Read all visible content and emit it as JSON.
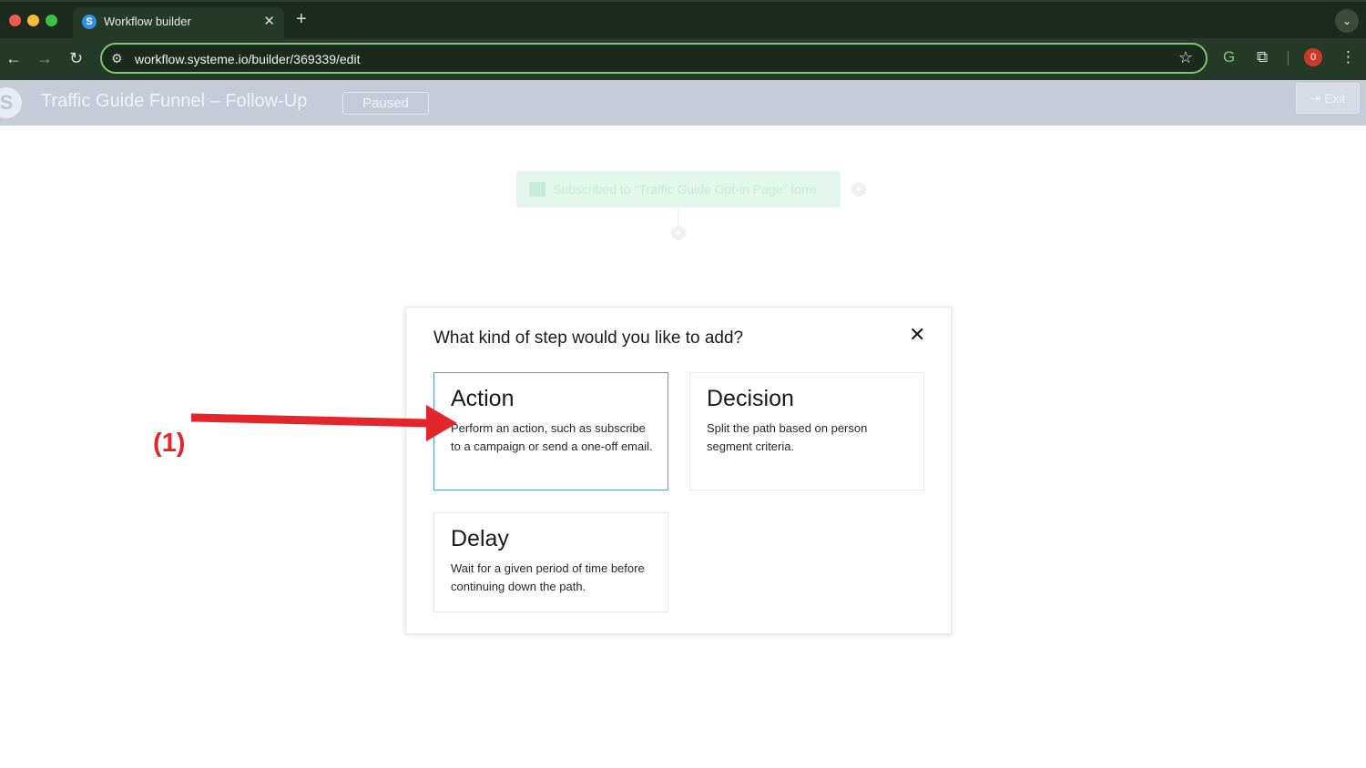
{
  "browser": {
    "tab_title": "Workflow builder",
    "tab_favicon_letter": "S",
    "tab_close": "✕",
    "new_tab": "+",
    "tab_menu": "⌄",
    "url": "workflow.systeme.io/builder/369339/edit",
    "profile_initial": "0",
    "accent_color": "#7ec86f"
  },
  "app": {
    "logo_letter": "S",
    "title": "Traffic Guide Funnel – Follow-Up",
    "status": "Paused",
    "exit_label": "Exit"
  },
  "canvas": {
    "trigger_label": "Subscribed to \"Traffic Guide Opt-in Page\" form",
    "add_symbol": "+"
  },
  "modal": {
    "title": "What kind of step would you like to add?",
    "close_symbol": "✕",
    "steps": [
      {
        "title": "Action",
        "description": "Perform an action, such as subscribe to a campaign or send a one-off email.",
        "selected": true
      },
      {
        "title": "Decision",
        "description": "Split the path based on person segment criteria.",
        "selected": false
      },
      {
        "title": "Delay",
        "description": "Wait for a given period of time before continuing down the path.",
        "selected": false
      }
    ]
  },
  "annotation": {
    "label": "(1)",
    "color": "#e3262c"
  }
}
